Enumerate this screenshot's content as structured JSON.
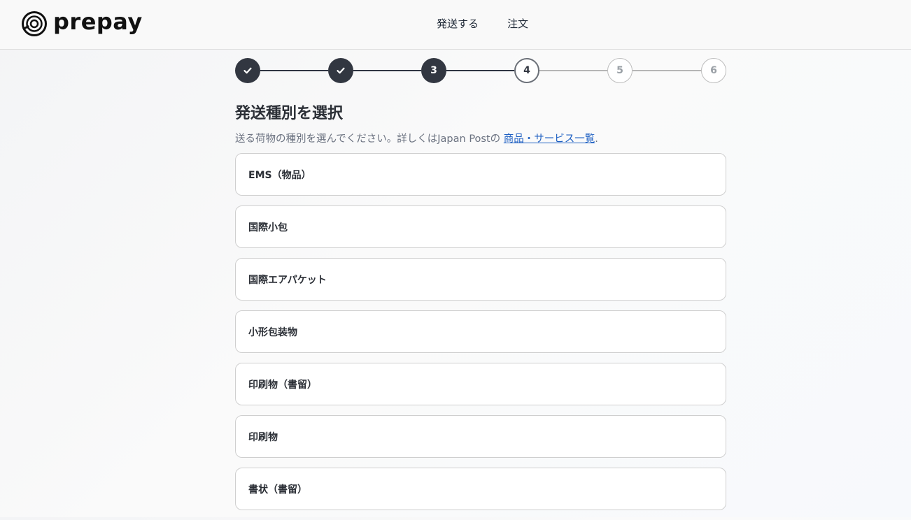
{
  "header": {
    "logo_text": "prepay",
    "nav": [
      {
        "label": "発送する"
      },
      {
        "label": "注文"
      }
    ]
  },
  "stepper": {
    "steps": [
      {
        "label": "",
        "state": "done"
      },
      {
        "label": "",
        "state": "done"
      },
      {
        "label": "3",
        "state": "done"
      },
      {
        "label": "4",
        "state": "current"
      },
      {
        "label": "5",
        "state": "todo"
      },
      {
        "label": "6",
        "state": "todo"
      }
    ]
  },
  "main": {
    "title": "発送種別を選択",
    "subtitle_text": "送る荷物の種別を選んでください。詳しくはJapan Postの ",
    "subtitle_link": "商品・サービス一覧",
    "subtitle_end": ".",
    "options": [
      {
        "label": "EMS（物品）"
      },
      {
        "label": "国際小包"
      },
      {
        "label": "国際エアパケット"
      },
      {
        "label": "小形包装物"
      },
      {
        "label": "印刷物（書留）"
      },
      {
        "label": "印刷物"
      },
      {
        "label": "書状（書留）"
      }
    ]
  },
  "colors": {
    "step_done": "#323741",
    "link": "#1d5fc2"
  }
}
